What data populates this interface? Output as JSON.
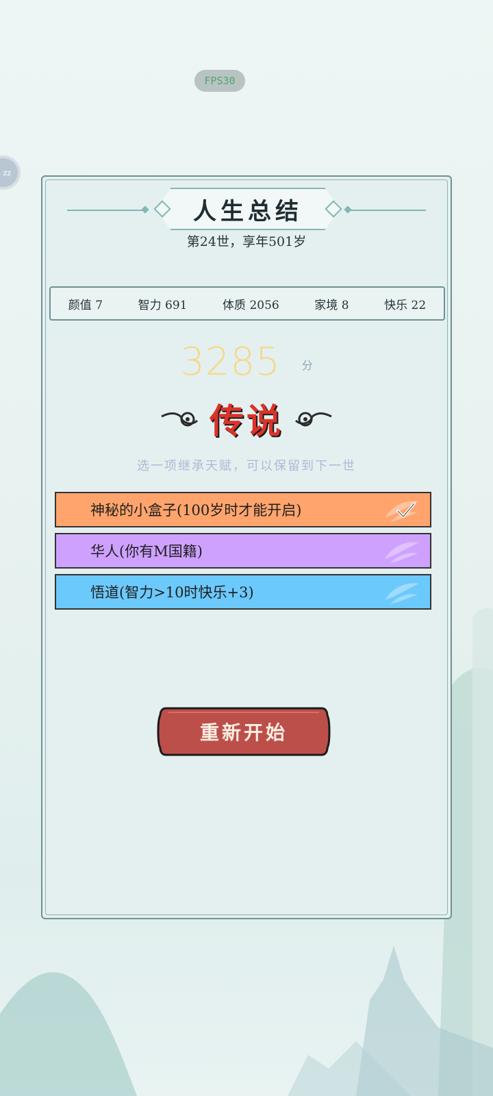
{
  "overlay": {
    "fps": "FPS30",
    "side_bubble": "zz"
  },
  "panel": {
    "title": "人生总结",
    "subtitle": "第24世，享年501岁"
  },
  "stats": [
    {
      "label": "颜值",
      "value": "7"
    },
    {
      "label": "智力",
      "value": "691"
    },
    {
      "label": "体质",
      "value": "2056"
    },
    {
      "label": "家境",
      "value": "8"
    },
    {
      "label": "快乐",
      "value": "22"
    }
  ],
  "score": {
    "value": "3285",
    "unit": "分"
  },
  "rank": "传说",
  "hint": "选一项继承天赋，可以保留到下一世",
  "talents": [
    {
      "label": "神秘的小盒子(100岁时才能开启)",
      "color": "#ffa46c",
      "selected": true
    },
    {
      "label": "华人(你有M国籍)",
      "color": "#cfa1ff",
      "selected": false
    },
    {
      "label": "悟道(智力>10时快乐+3)",
      "color": "#6cc9fb",
      "selected": false
    }
  ],
  "restart_label": "重新开始",
  "colors": {
    "panel_bg": "#e4f0ef",
    "panel_border": "#6f9294",
    "score": "#f6d88a",
    "rank": "#d9332a",
    "restart_bg": "#bd4f4b"
  },
  "icons": [
    "check-icon",
    "bamboo-leaf-icon",
    "cloud-swirl-icon"
  ]
}
